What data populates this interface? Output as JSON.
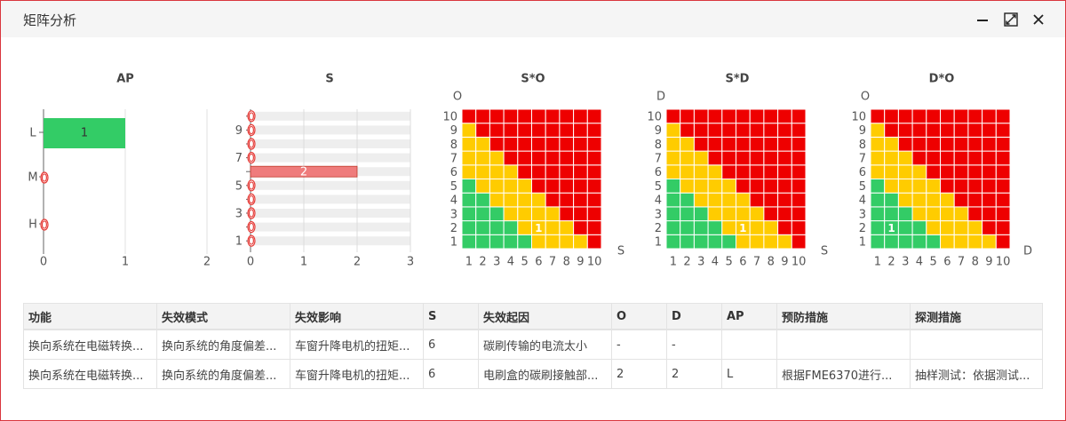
{
  "window": {
    "title": "矩阵分析"
  },
  "charts": {
    "ap": {
      "title": "AP",
      "categories": [
        "L",
        "M",
        "H"
      ],
      "values": [
        1,
        0,
        0
      ],
      "x_ticks": [
        "0",
        "1",
        "2"
      ],
      "bar_color": "#33cc66",
      "zero_marker_color": "#e53935"
    },
    "s": {
      "title": "S",
      "y_tick_labels": [
        "1",
        "3",
        "5",
        "7",
        "9"
      ],
      "values": [
        0,
        0,
        0,
        0,
        0,
        2,
        0,
        0,
        0,
        0
      ],
      "x_ticks": [
        "0",
        "1",
        "2",
        "3"
      ],
      "bar_color": "#ef7c7c",
      "band_color": "#eeeeee"
    },
    "matrices": [
      {
        "title": "S*O",
        "y_axis": "O",
        "x_axis": "S",
        "marker": {
          "col": 6,
          "row": 2,
          "label": "1"
        }
      },
      {
        "title": "S*D",
        "y_axis": "D",
        "x_axis": "S",
        "marker": {
          "col": 6,
          "row": 2,
          "label": "1"
        }
      },
      {
        "title": "D*O",
        "y_axis": "O",
        "x_axis": "D",
        "marker": {
          "col": 2,
          "row": 2,
          "label": "1"
        }
      }
    ],
    "matrix_ticks": [
      "1",
      "2",
      "3",
      "4",
      "5",
      "6",
      "7",
      "8",
      "9",
      "10"
    ],
    "colors": {
      "high": "#ee0000",
      "medium": "#ffcc00",
      "low": "#33cc66"
    }
  },
  "table": {
    "columns": [
      "功能",
      "失效模式",
      "失效影响",
      "S",
      "失效起因",
      "O",
      "D",
      "AP",
      "预防措施",
      "探测措施"
    ],
    "rows": [
      [
        "换向系统在电磁转换...",
        "换向系统的角度偏差...",
        "车窗升降电机的扭矩...",
        "6",
        "碳刷传输的电流太小",
        "-",
        "-",
        "",
        "",
        ""
      ],
      [
        "换向系统在电磁转换...",
        "换向系统的角度偏差...",
        "车窗升降电机的扭矩...",
        "6",
        "电刷盒的碳刷接触部...",
        "2",
        "2",
        "L",
        "根据FME6370进行...",
        "抽样测试：依据测试..."
      ]
    ]
  }
}
